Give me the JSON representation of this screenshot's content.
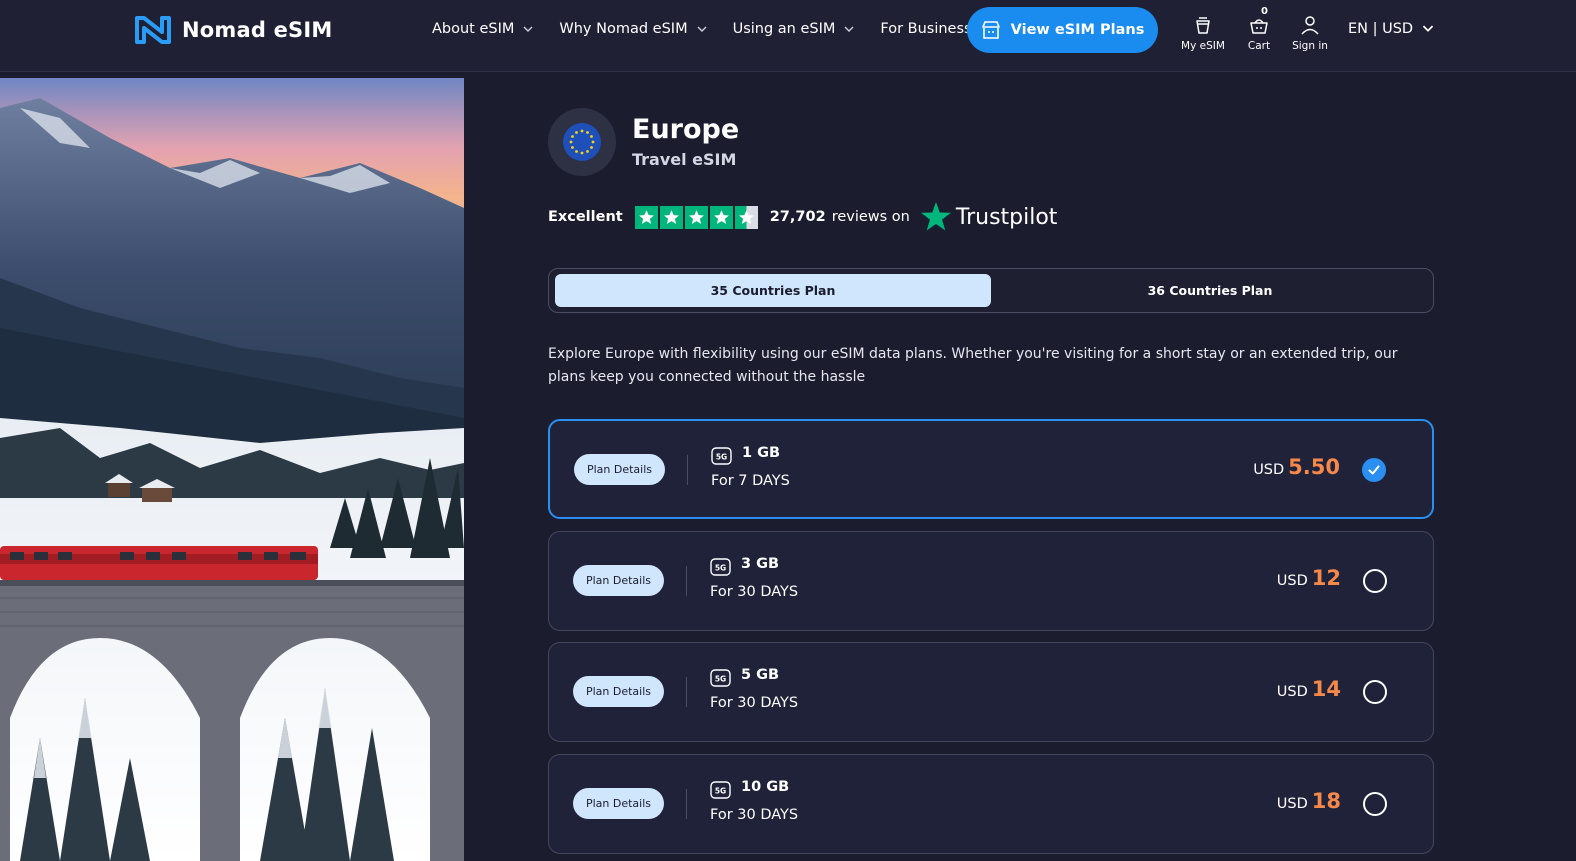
{
  "brand": {
    "name": "Nomad eSIM"
  },
  "nav": {
    "links": [
      {
        "label": "About eSIM",
        "has_dropdown": true
      },
      {
        "label": "Why Nomad eSIM",
        "has_dropdown": true
      },
      {
        "label": "Using an eSIM",
        "has_dropdown": true
      },
      {
        "label": "For Business",
        "has_dropdown": false
      }
    ],
    "cta_label": "View eSIM Plans",
    "my_esim_label": "My eSIM",
    "cart_label": "Cart",
    "cart_count": "0",
    "signin_label": "Sign in",
    "locale_label": "EN | USD"
  },
  "region": {
    "title": "Europe",
    "subtitle": "Travel eSIM"
  },
  "rating": {
    "label": "Excellent",
    "stars": 4.5,
    "reviews_count": "27,702",
    "reviews_text": "reviews on",
    "provider": "Trustpilot"
  },
  "tabs": [
    {
      "label": "35 Countries Plan",
      "active": true
    },
    {
      "label": "36 Countries Plan",
      "active": false
    }
  ],
  "description": "Explore Europe with flexibility using our eSIM data plans. Whether you're visiting for a short stay or an extended trip, our plans keep you connected without the hassle",
  "plans": [
    {
      "details_label": "Plan Details",
      "network": "5G",
      "data": "1 GB",
      "duration": "For 7 DAYS",
      "currency": "USD",
      "price": "5.50",
      "selected": true
    },
    {
      "details_label": "Plan Details",
      "network": "5G",
      "data": "3 GB",
      "duration": "For 30 DAYS",
      "currency": "USD",
      "price": "12",
      "selected": false
    },
    {
      "details_label": "Plan Details",
      "network": "5G",
      "data": "5 GB",
      "duration": "For 30 DAYS",
      "currency": "USD",
      "price": "14",
      "selected": false
    },
    {
      "details_label": "Plan Details",
      "network": "5G",
      "data": "10 GB",
      "duration": "For 30 DAYS",
      "currency": "USD",
      "price": "18",
      "selected": false
    }
  ],
  "colors": {
    "background": "#1b1c2e",
    "accent": "#1a8cf0",
    "price": "#f6894a",
    "trustpilot_green": "#00b67a",
    "tab_active": "#cfe6fd"
  }
}
